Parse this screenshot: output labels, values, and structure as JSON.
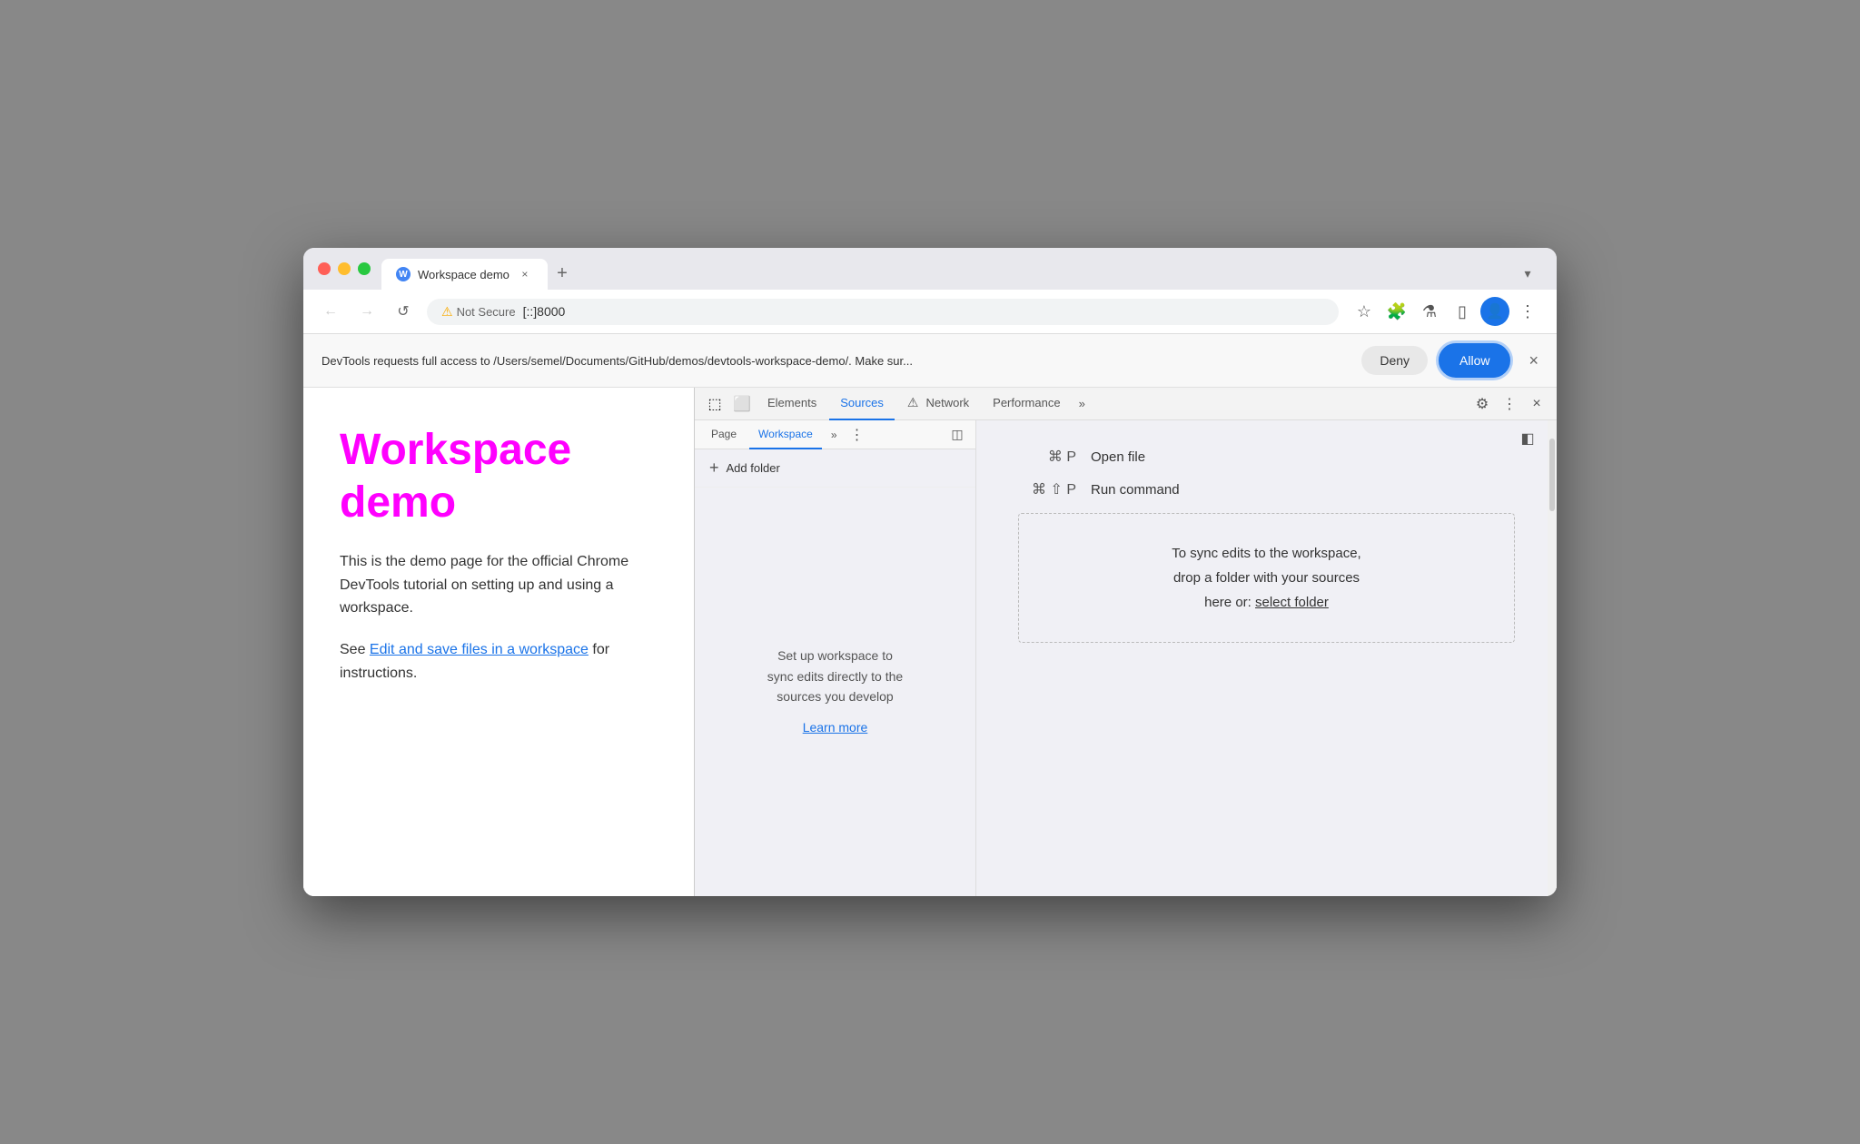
{
  "browser": {
    "tab": {
      "favicon_label": "W",
      "title": "Workspace demo",
      "close_label": "×",
      "new_tab_label": "+"
    },
    "nav": {
      "back_label": "←",
      "forward_label": "→",
      "reload_label": "↺",
      "warning_label": "⚠",
      "not_secure_label": "Not Secure",
      "url": "[::]8000",
      "bookmark_label": "☆",
      "extension_label": "🧩",
      "labs_label": "⚗",
      "sidebar_label": "▯",
      "profile_label": "👤",
      "menu_label": "⋮"
    },
    "permission_bar": {
      "message": "DevTools requests full access to /Users/semel/Documents/GitHub/demos/devtools-workspace-demo/. Make sur...",
      "deny_label": "Deny",
      "allow_label": "Allow",
      "close_label": "×"
    }
  },
  "page": {
    "title": "Workspace demo",
    "body1": "This is the demo page for the official Chrome DevTools tutorial on setting up and using a workspace.",
    "body2": "See ",
    "link_text": "Edit and save files in a workspace",
    "body3": " for instructions."
  },
  "devtools": {
    "tabs": [
      {
        "label": "Elements",
        "active": false
      },
      {
        "label": "Sources",
        "active": true
      },
      {
        "label": "Network",
        "active": false,
        "warning": true
      },
      {
        "label": "Performance",
        "active": false
      }
    ],
    "more_tabs_label": "»",
    "settings_label": "⚙",
    "kebab_label": "⋮",
    "close_label": "×",
    "inspect_icon_label": "⬚",
    "device_icon_label": "⬜",
    "subtabs": [
      {
        "label": "Page",
        "active": false
      },
      {
        "label": "Workspace",
        "active": true
      }
    ],
    "subtab_more_label": "»",
    "subtab_kebab_label": "⋮",
    "subtab_panel_label": "◫",
    "add_folder_label": "+ Add folder",
    "workspace_info": "Set up workspace to\nsync edits directly to the\nsources you develop",
    "learn_more_label": "Learn more",
    "shortcuts": [
      {
        "keys": "⌘ P",
        "action": "Open file"
      },
      {
        "keys": "⌘ ⇧ P",
        "action": "Run command"
      }
    ],
    "drop_zone_line1": "To sync edits to the workspace,",
    "drop_zone_line2": "drop a folder with your sources",
    "drop_zone_line3": "here or: ",
    "drop_zone_link": "select folder",
    "right_panel_label": "◧"
  }
}
